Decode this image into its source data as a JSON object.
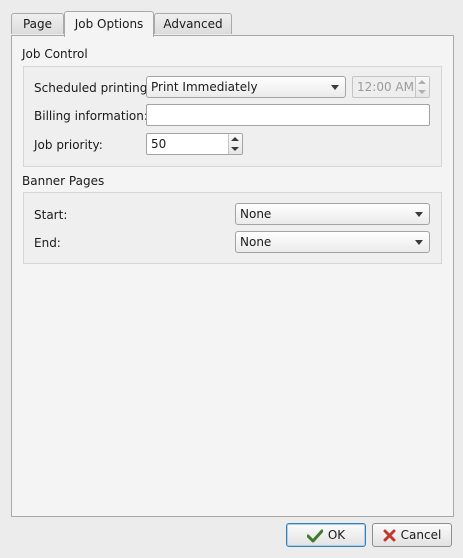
{
  "tabs": [
    {
      "label": "Page"
    },
    {
      "label": "Job Options"
    },
    {
      "label": "Advanced"
    }
  ],
  "job_control": {
    "title": "Job Control",
    "scheduled_label": "Scheduled printing:",
    "scheduled_value": "Print Immediately",
    "time_value": "12:00 AM",
    "billing_label": "Billing information:",
    "billing_value": "",
    "priority_label": "Job priority:",
    "priority_value": "50"
  },
  "banner_pages": {
    "title": "Banner Pages",
    "start_label": "Start:",
    "start_value": "None",
    "end_label": "End:",
    "end_value": "None"
  },
  "buttons": {
    "ok_label": "OK",
    "cancel_label": "Cancel",
    "ok_icon": "checkmark-icon",
    "cancel_icon": "cancel-x-icon"
  },
  "colors": {
    "ok_icon": "#3f7a2c",
    "cancel_icon": "#c0392b",
    "default_button_border": "#3c7fb1"
  }
}
